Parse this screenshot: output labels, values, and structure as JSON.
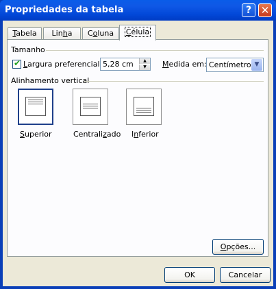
{
  "window": {
    "title": "Propriedades da tabela",
    "help_glyph": "?",
    "close_glyph": "✕"
  },
  "tabs": [
    {
      "label": "Tabela",
      "accel": "T",
      "rest": "abela",
      "active": false
    },
    {
      "label": "Linha",
      "accel": "",
      "rest": "",
      "active": false
    },
    {
      "label": "Coluna",
      "accel": "",
      "rest": "",
      "active": false
    },
    {
      "label": "Célula",
      "accel": "C",
      "rest": "élula",
      "active": true
    }
  ],
  "size_group": {
    "title": "Tamanho",
    "preferred_width": {
      "checked": true,
      "label_accel": "L",
      "label_rest": "argura preferencial:",
      "value": "5,28 cm"
    },
    "measure": {
      "label_accel": "M",
      "label_rest": "edida em:",
      "value": "Centímetros"
    }
  },
  "valign_group": {
    "title": "Alinhamento vertical",
    "options": [
      {
        "label_accel": "S",
        "label_rest": "uperior",
        "selected": true
      },
      {
        "label_pre": "Centrali",
        "label_accel": "z",
        "label_post": "ado",
        "selected": false
      },
      {
        "label_pre": "I",
        "label_accel": "n",
        "label_post": "ferior",
        "selected": false
      }
    ]
  },
  "options_button": {
    "accel": "O",
    "rest": "pções..."
  },
  "footer": {
    "ok_label": "OK",
    "cancel_label": "Cancelar"
  },
  "colors": {
    "titlebar": "#0a5ce8",
    "dialog_bg": "#ece9d8",
    "tab_panel_bg": "#fcfcfe",
    "check_mark": "#21a121"
  }
}
